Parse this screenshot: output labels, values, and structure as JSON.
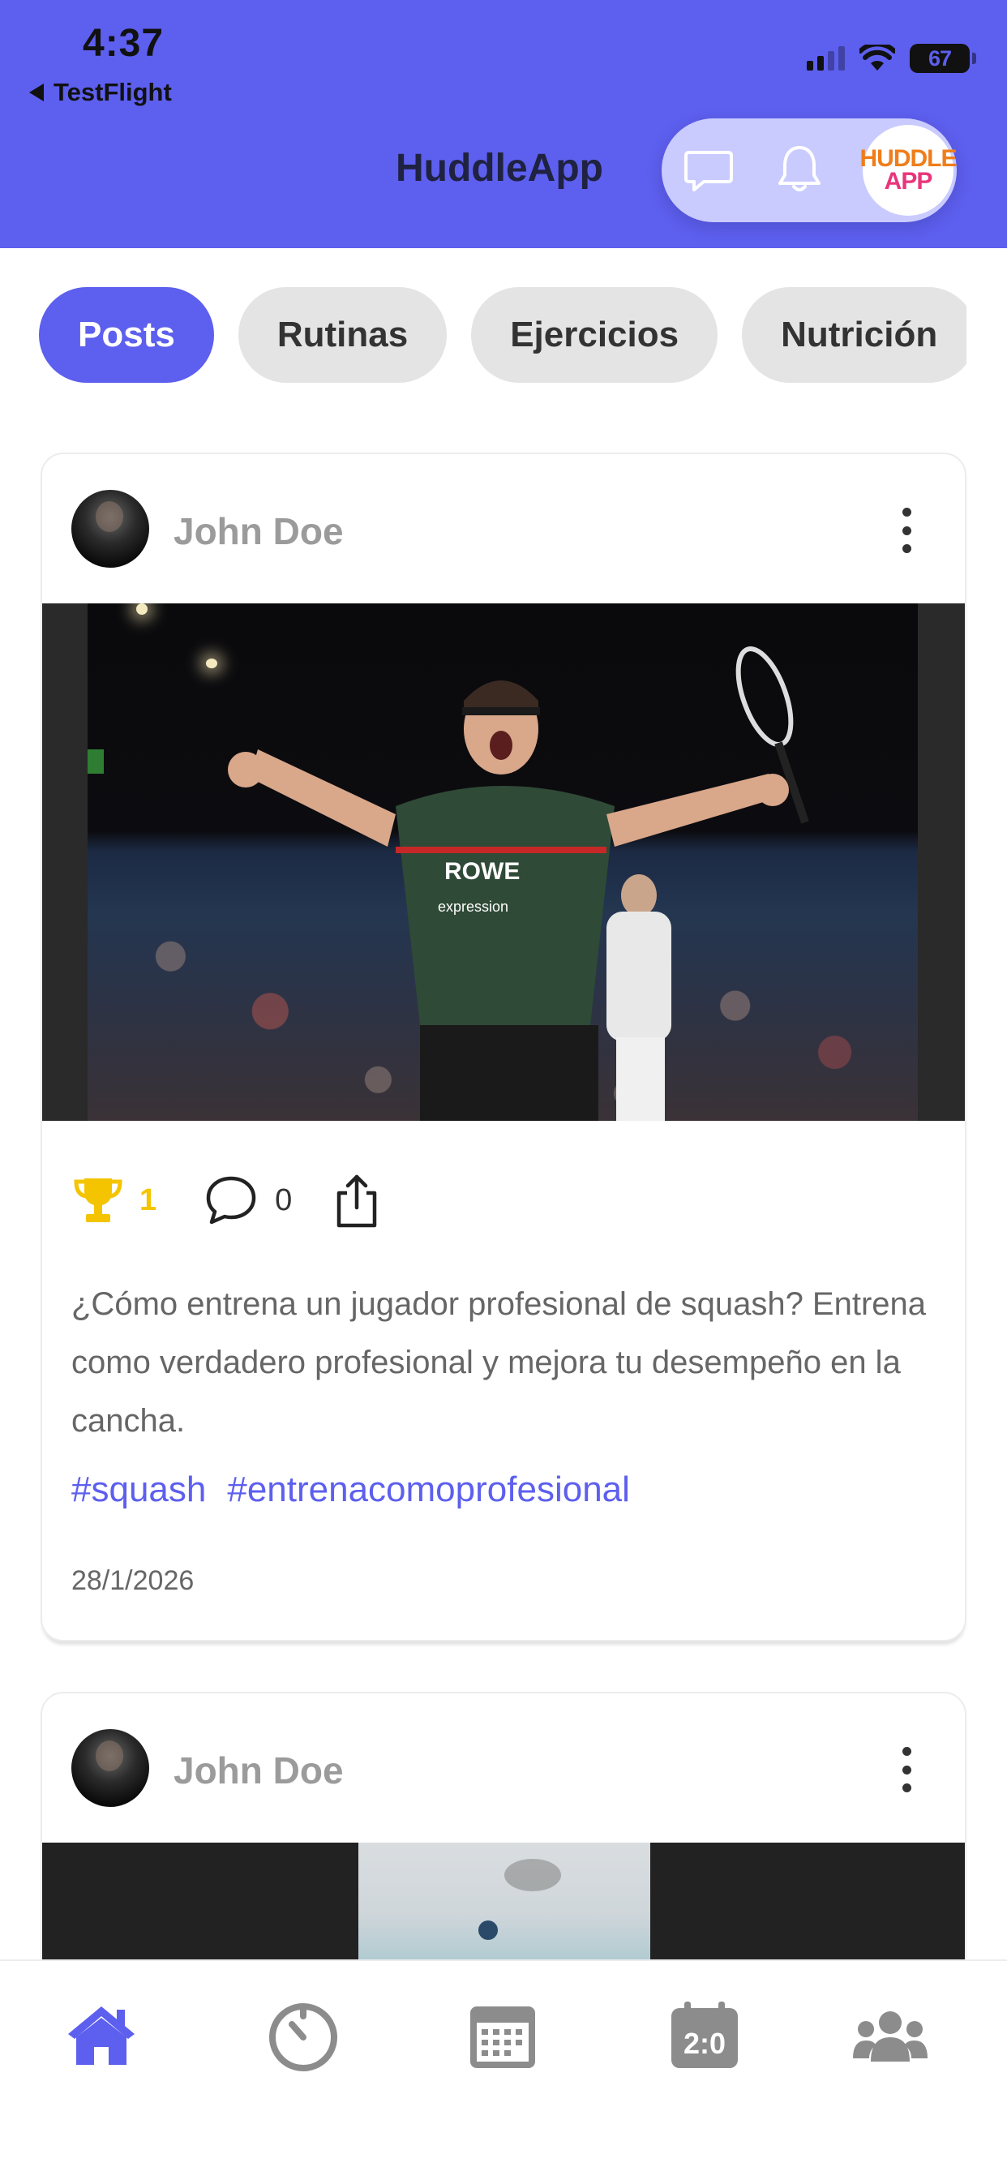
{
  "status_bar": {
    "time": "4:37",
    "back_label": "TestFlight",
    "battery_level": "67"
  },
  "header": {
    "title": "HuddleApp",
    "logo_line1": "HUDDLE",
    "logo_line2": "APP",
    "icons": [
      "chat-bubble-icon",
      "bell-icon"
    ]
  },
  "tabs": [
    {
      "label": "Posts",
      "active": true
    },
    {
      "label": "Rutinas",
      "active": false
    },
    {
      "label": "Ejercicios",
      "active": false
    },
    {
      "label": "Nutrición",
      "active": false
    }
  ],
  "posts": [
    {
      "author": "John Doe",
      "likes": "1",
      "comments": "0",
      "text": "¿Cómo entrena un jugador profesional de squash? Entrena como verdadero profesional y mejora tu desempeño en la cancha.",
      "tags": [
        "#squash",
        "#entrenacomoprofesional"
      ],
      "date": "28/1/2026"
    },
    {
      "author": "John Doe"
    }
  ],
  "bottom_nav": {
    "items": [
      "home-icon",
      "timer-icon",
      "calendar-icon",
      "scoreboard-icon",
      "team-icon"
    ],
    "active": "home-icon"
  },
  "colors": {
    "accent": "#5d5fee",
    "trophy": "#f4c400",
    "header_pill": "#c9cbff",
    "inactive_icon": "#8c8c8c"
  }
}
